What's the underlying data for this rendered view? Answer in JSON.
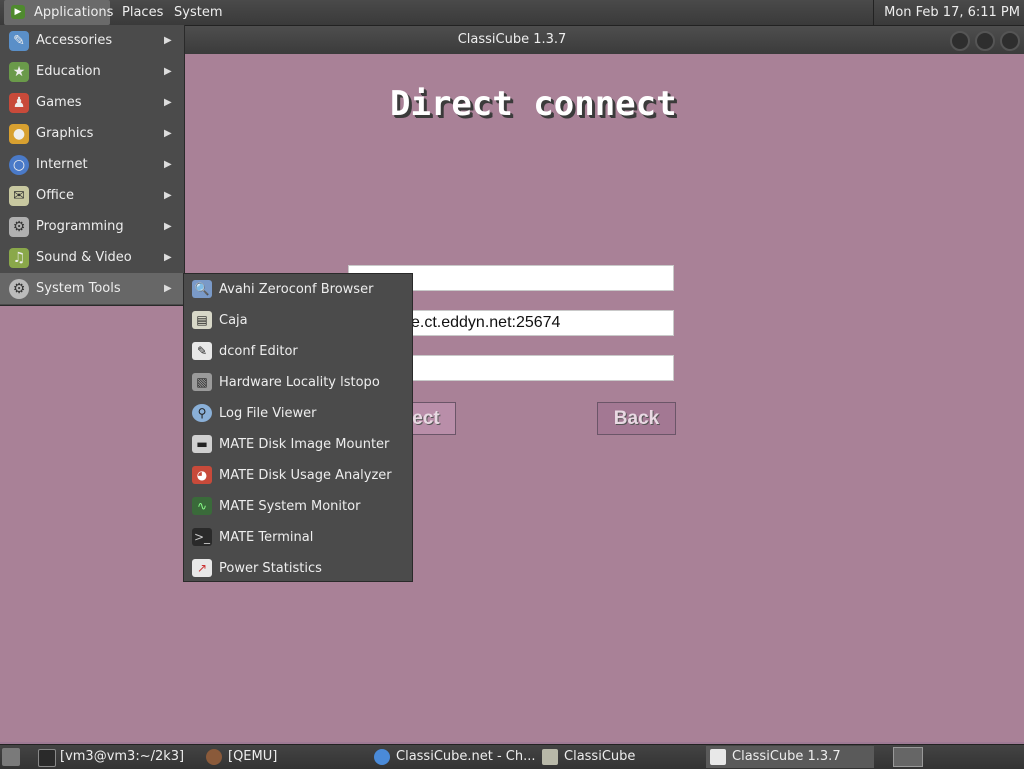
{
  "top_panel": {
    "applications": "Applications",
    "places": "Places",
    "system": "System",
    "clock": "Mon Feb 17,  6:11 PM"
  },
  "window": {
    "title": "ClassiCube 1.3.7",
    "screen_title": "Direct connect",
    "ip_value": "e.ct.eddyn.net:25674",
    "connect_label": "ect",
    "back_label": "Back"
  },
  "apps_menu": {
    "items": [
      {
        "label": "Accessories",
        "icon": "accessories-icon",
        "color": "#5a8fc8"
      },
      {
        "label": "Education",
        "icon": "education-icon",
        "color": "#6a9a4a"
      },
      {
        "label": "Games",
        "icon": "games-icon",
        "color": "#c84a3a"
      },
      {
        "label": "Graphics",
        "icon": "graphics-icon",
        "color": "#d8a030"
      },
      {
        "label": "Internet",
        "icon": "internet-icon",
        "color": "#4a7ac8"
      },
      {
        "label": "Office",
        "icon": "office-icon",
        "color": "#c8c8a0"
      },
      {
        "label": "Programming",
        "icon": "programming-icon",
        "color": "#b0b0b0"
      },
      {
        "label": "Sound & Video",
        "icon": "sound-video-icon",
        "color": "#8aa84a"
      },
      {
        "label": "System Tools",
        "icon": "system-tools-icon",
        "color": "#bbbbbb"
      }
    ]
  },
  "system_tools_menu": {
    "items": [
      {
        "label": "Avahi Zeroconf Browser",
        "icon": "avahi-icon",
        "color": "#7a9ac8"
      },
      {
        "label": "Caja",
        "icon": "caja-icon",
        "color": "#d8d8c8"
      },
      {
        "label": "dconf Editor",
        "icon": "dconf-icon",
        "color": "#e8e8e8"
      },
      {
        "label": "Hardware Locality lstopo",
        "icon": "hardware-icon",
        "color": "#9a9a9a"
      },
      {
        "label": "Log File Viewer",
        "icon": "log-viewer-icon",
        "color": "#8ab0d8"
      },
      {
        "label": "MATE Disk Image Mounter",
        "icon": "disk-mounter-icon",
        "color": "#d0d0d0"
      },
      {
        "label": "MATE Disk Usage Analyzer",
        "icon": "disk-usage-icon",
        "color": "#c84a3a"
      },
      {
        "label": "MATE System Monitor",
        "icon": "system-monitor-icon",
        "color": "#3a6a3a"
      },
      {
        "label": "MATE Terminal",
        "icon": "terminal-icon",
        "color": "#2a2a2a"
      },
      {
        "label": "Power Statistics",
        "icon": "power-stats-icon",
        "color": "#e8e8e8"
      }
    ]
  },
  "taskbar": {
    "tasks": [
      {
        "label": "[vm3@vm3:~/2k3]",
        "icon": "terminal-icon"
      },
      {
        "label": "[QEMU]",
        "icon": "qemu-icon"
      },
      {
        "label": "ClassiCube.net - Ch...",
        "icon": "chromium-icon"
      },
      {
        "label": "ClassiCube",
        "icon": "folder-icon"
      },
      {
        "label": "ClassiCube 1.3.7",
        "icon": "classicube-icon"
      }
    ]
  }
}
